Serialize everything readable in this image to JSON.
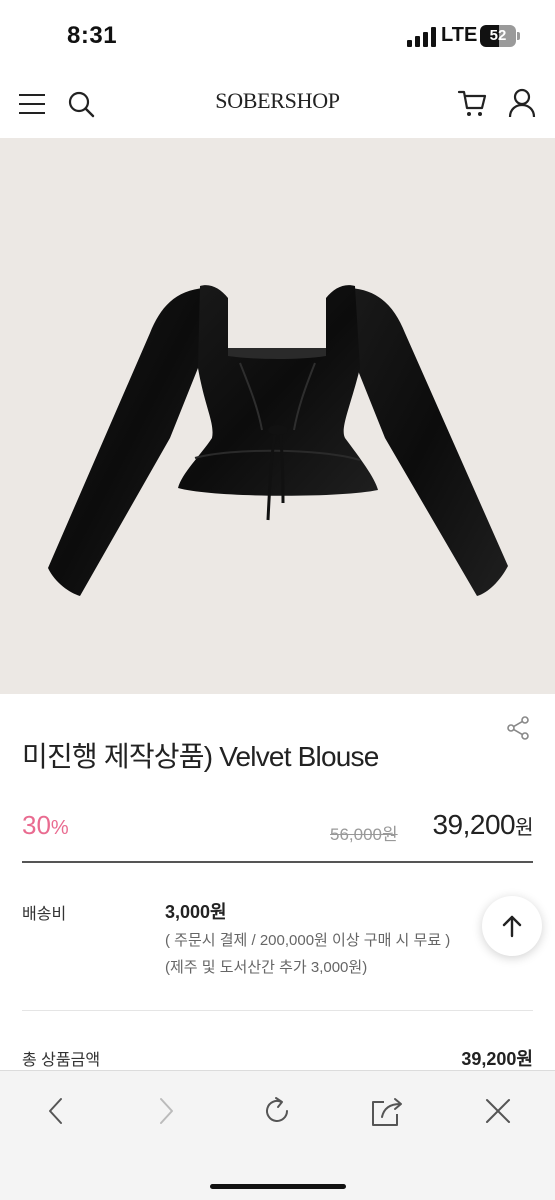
{
  "status_bar": {
    "time": "8:31",
    "network": "LTE",
    "battery": "52",
    "battery_level": 0.52
  },
  "header": {
    "logo": "SOBERSHOP",
    "menu_icon": "hamburger-menu-icon",
    "search_icon": "search-icon",
    "cart_icon": "cart-icon",
    "user_icon": "user-icon"
  },
  "product": {
    "image_alt": "black velvet blouse",
    "title": "미진행 제작상품) Velvet Blouse",
    "discount_value": "30",
    "discount_unit": "%",
    "original_price": "56,000원",
    "sale_price_number": "39,200",
    "sale_price_unit": "원",
    "share_icon": "share-icon"
  },
  "shipping": {
    "label": "배송비",
    "fee": "3,000원",
    "note1": "( 주문시 결제 / 200,000원 이상 구매 시 무료 )",
    "note2": "(제주 및 도서산간 추가 3,000원)"
  },
  "total": {
    "label": "총 상품금액",
    "value": "39,200원"
  },
  "colors": {
    "accent_pink": "#e96b90",
    "image_bg": "#ece8e4",
    "toolbar_bg": "#f4f4f4"
  },
  "browser_toolbar": {
    "back_icon": "back-icon",
    "forward_icon": "forward-icon",
    "reload_icon": "reload-icon",
    "share_icon": "share-out-icon",
    "close_icon": "close-icon"
  }
}
